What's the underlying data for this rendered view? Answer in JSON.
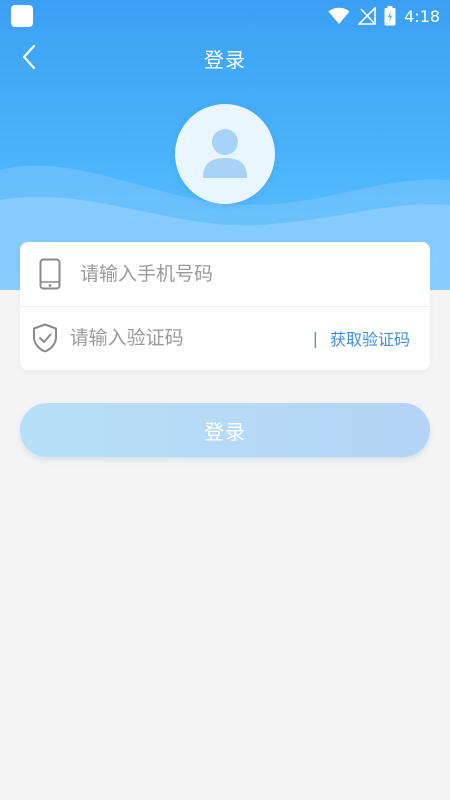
{
  "status_bar": {
    "time": "4:18"
  },
  "nav": {
    "title": "登录",
    "back_icon": "chevron-left-icon"
  },
  "avatar": {
    "icon": "user-icon"
  },
  "form": {
    "phone": {
      "icon": "phone-icon",
      "placeholder": "请输入手机号码",
      "value": ""
    },
    "code": {
      "icon": "shield-check-icon",
      "placeholder": "请输入验证码",
      "value": "",
      "separator": "|",
      "get_code_label": "获取验证码"
    }
  },
  "login_button": {
    "label": "登录"
  },
  "colors": {
    "accent": "#3d8fe0",
    "hero_top": "#3ba0f5",
    "hero_bottom": "#62c7ff",
    "button_start": "#b6e0f7",
    "button_end": "#b5d3f5"
  }
}
